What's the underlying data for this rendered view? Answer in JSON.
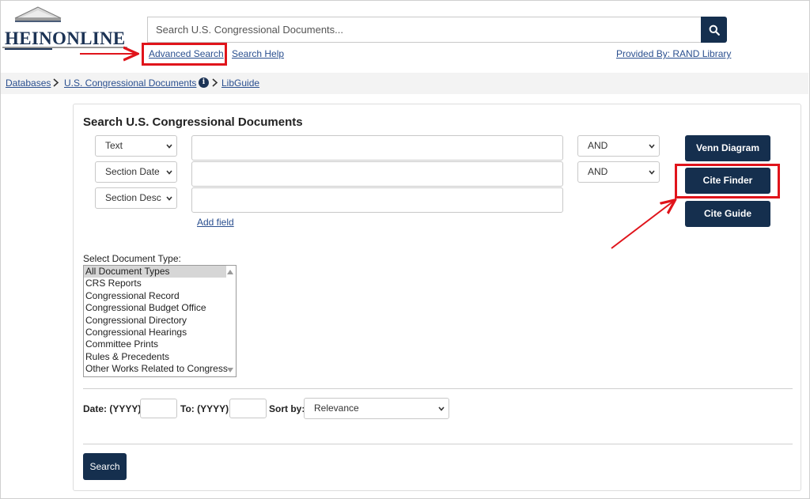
{
  "logo": {
    "part1": "HEIN",
    "part2": "ONLINE"
  },
  "header": {
    "search_placeholder": "Search U.S. Congressional Documents...",
    "advanced_search": "Advanced Search",
    "search_help": "Search Help",
    "provided_by": "Provided By: RAND Library"
  },
  "breadcrumb": {
    "databases": "Databases",
    "collection": "U.S. Congressional Documents",
    "libguide": "LibGuide"
  },
  "form": {
    "title": "Search U.S. Congressional Documents",
    "rows": [
      {
        "field": "Text",
        "operator": "AND"
      },
      {
        "field": "Section Date",
        "operator": "AND"
      },
      {
        "field": "Section Desc",
        "operator": ""
      }
    ],
    "add_field": "Add field",
    "venn_button": "Venn Diagram",
    "cite_finder_button": "Cite Finder",
    "cite_guide_button": "Cite Guide",
    "doc_type_label": "Select Document Type:",
    "doc_types": [
      "All Document Types",
      "CRS Reports",
      "Congressional Record",
      "Congressional Budget Office",
      "Congressional Directory",
      "Congressional Hearings",
      "Committee Prints",
      "Rules & Precedents",
      "Other Works Related to Congress"
    ],
    "date_from_label": "Date: (YYYY)",
    "date_to_label": "To: (YYYY)",
    "sort_label": "Sort by:",
    "sort_value": "Relevance",
    "search_button": "Search"
  },
  "colors": {
    "navy": "#152f4e",
    "link": "#2a4f8f",
    "highlight": "#e0141b"
  }
}
